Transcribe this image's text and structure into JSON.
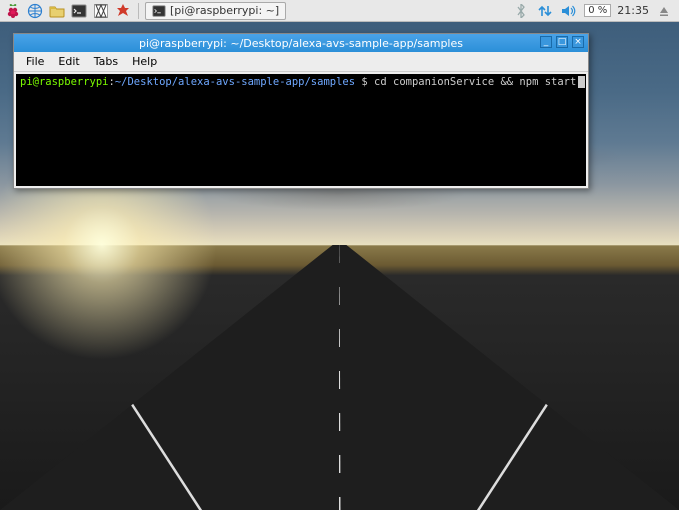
{
  "taskbar": {
    "icons": [
      {
        "name": "menu-raspberry-icon"
      },
      {
        "name": "browser-globe-icon"
      },
      {
        "name": "file-manager-icon"
      },
      {
        "name": "terminal-icon"
      },
      {
        "name": "mathematica-icon"
      },
      {
        "name": "wolfram-icon"
      }
    ],
    "task_button": {
      "icon": "terminal-icon",
      "label": "[pi@raspberrypi: ~]"
    },
    "tray": {
      "bluetooth": "bluetooth-icon",
      "network": "network-updown-icon",
      "volume": "volume-icon",
      "cpu": "0 %",
      "clock": "21:35",
      "eject": "eject-icon"
    }
  },
  "terminal_window": {
    "title": "pi@raspberrypi: ~/Desktop/alexa-avs-sample-app/samples",
    "menus": [
      "File",
      "Edit",
      "Tabs",
      "Help"
    ],
    "controls": {
      "min": "_",
      "max": "□",
      "close": "×"
    },
    "prompt": {
      "user_host": "pi@raspberrypi",
      "sep1": ":",
      "path": "~/Desktop/alexa-avs-sample-app/samples",
      "sigil": " $ ",
      "command": "cd companionService && npm start"
    }
  }
}
